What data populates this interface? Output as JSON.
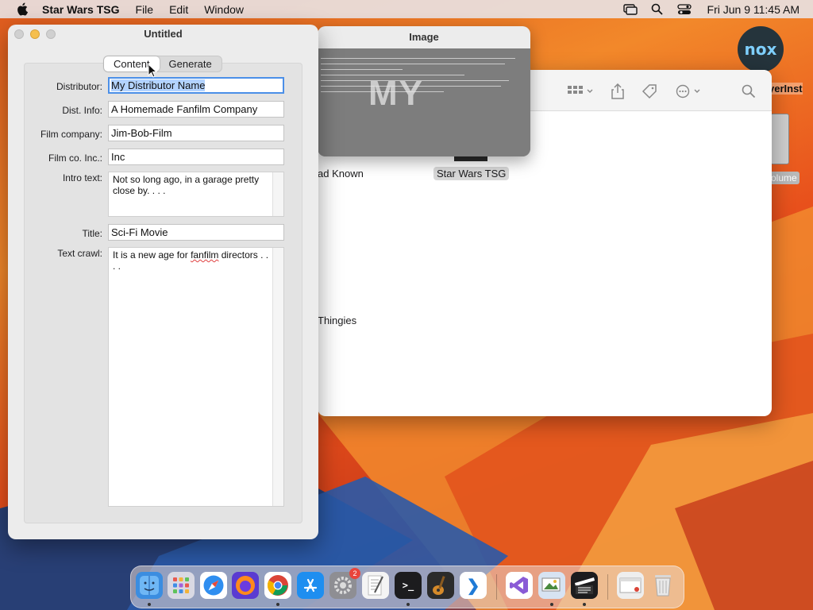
{
  "menubar": {
    "app_name": "Star Wars TSG",
    "items": [
      "File",
      "Edit",
      "Window"
    ],
    "clock": "Fri Jun 9  11:45 AM"
  },
  "desktop": {
    "nox_label": "nox",
    "label_a": "yerInst",
    "label_b": "olume"
  },
  "finder": {
    "item1_label": "ad Known",
    "item2_label": "Star Wars TSG",
    "item3_label": "Thingies"
  },
  "image_window": {
    "title": "Image",
    "logo_text": "MY"
  },
  "app_window": {
    "title": "Untitled",
    "tabs": [
      {
        "label": "Content",
        "active": true
      },
      {
        "label": "Generate",
        "active": false
      }
    ],
    "fields": {
      "distributor": {
        "label": "Distributor:",
        "value": "My Distributor Name"
      },
      "dist_info": {
        "label": "Dist. Info:",
        "value": "A Homemade Fanfilm Company"
      },
      "film_company": {
        "label": "Film company:",
        "value": "Jim-Bob-Film"
      },
      "film_co_inc": {
        "label": "Film co. Inc.:",
        "value": "Inc"
      },
      "intro_text": {
        "label": "Intro text:",
        "value": "Not so long ago, in a garage pretty close by. . . ."
      },
      "title": {
        "label": "Title:",
        "value": "Sci-Fi Movie"
      },
      "text_crawl": {
        "label": "Text crawl:",
        "value_start": "It is a new age for ",
        "value_underlined": "fanfilm",
        "value_end": " directors . . . ."
      }
    }
  },
  "dock": {
    "settings_badge": "2",
    "terminal_glyph": ">_",
    "vscode_glyph": "❯"
  }
}
